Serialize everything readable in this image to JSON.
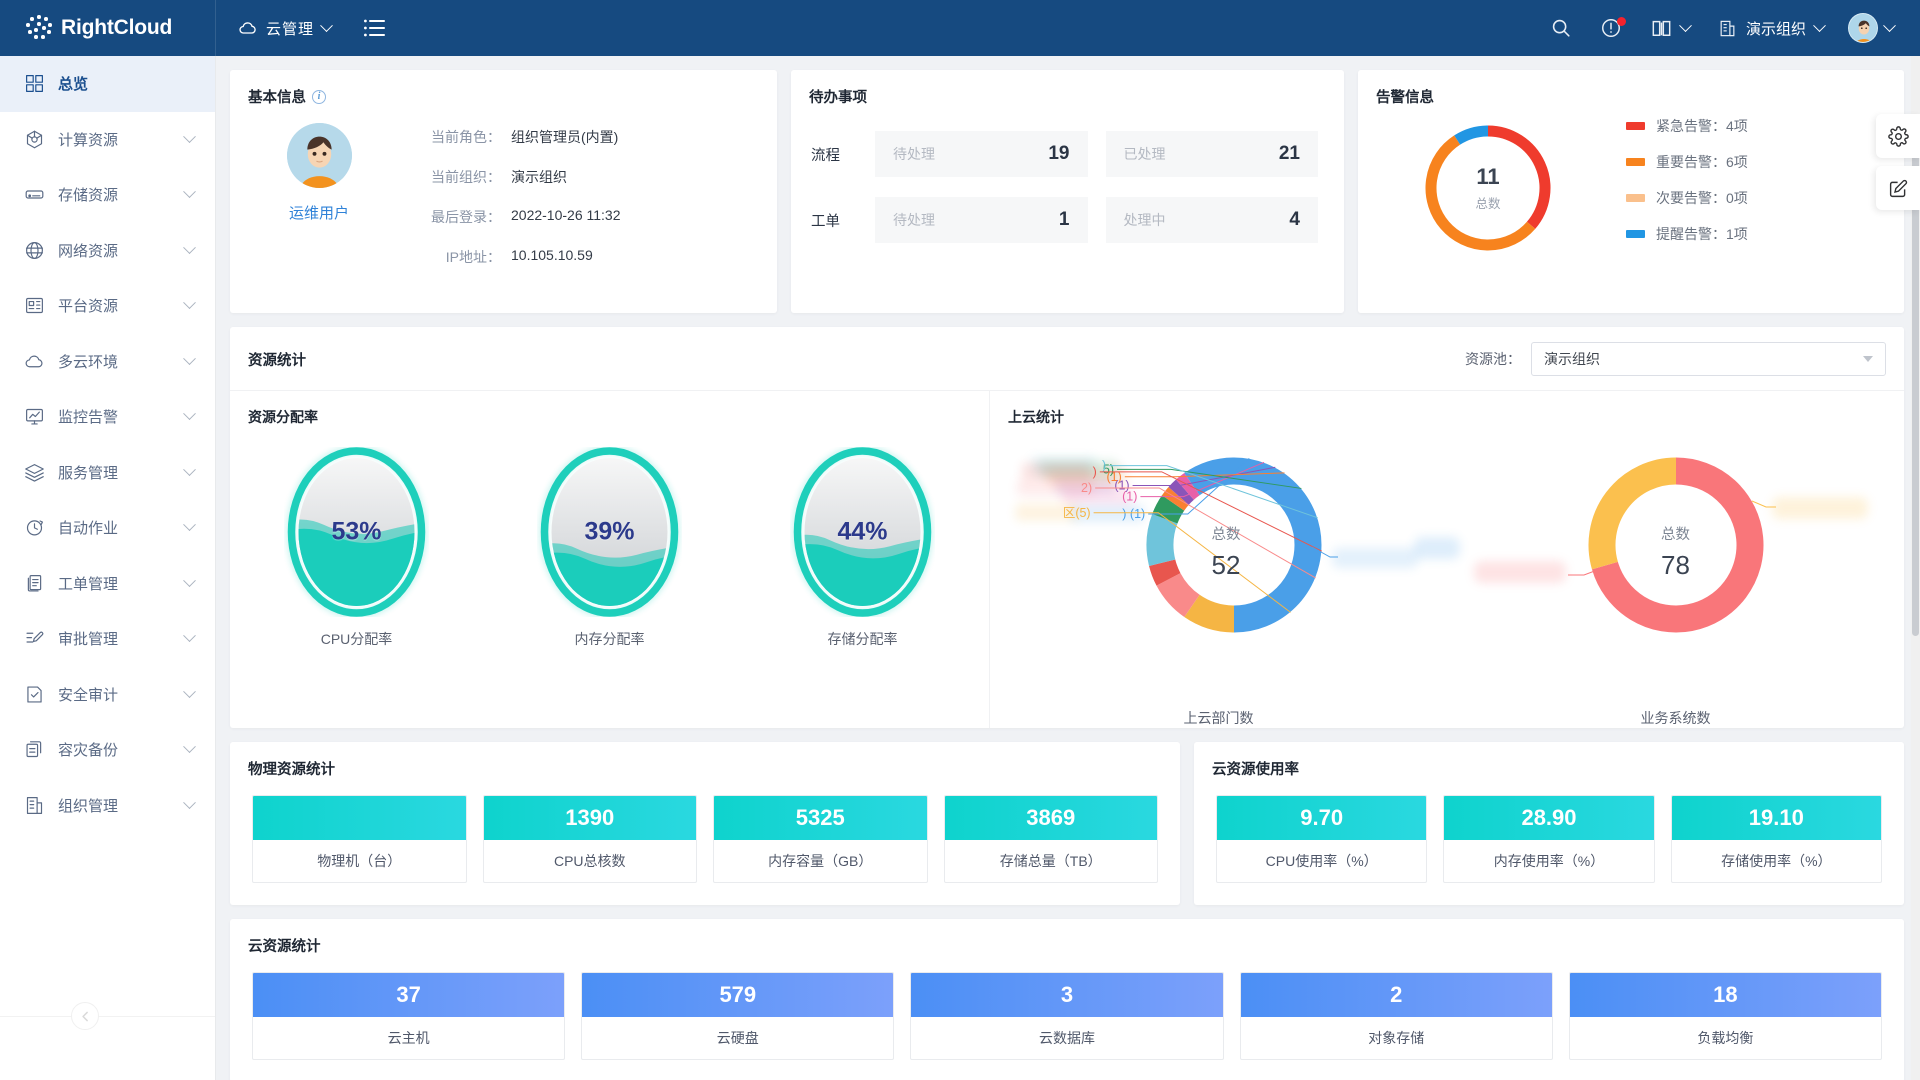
{
  "header": {
    "brand": "RightCloud",
    "module": "云管理",
    "module_icon": "cloud-icon",
    "menu_icon": "hamburger-icon",
    "search_icon": "search-icon",
    "help_icon": "exclamation-circle-icon",
    "docs_icon": "book-icon",
    "org_icon": "building-icon",
    "org_name": "演示组织",
    "avatar_icon": "user-avatar"
  },
  "sidebar": {
    "items": [
      {
        "label": "总览",
        "icon": "grid-icon",
        "active": true,
        "expandable": false
      },
      {
        "label": "计算资源",
        "icon": "cpu-icon",
        "active": false,
        "expandable": true
      },
      {
        "label": "存储资源",
        "icon": "storage-icon",
        "active": false,
        "expandable": true
      },
      {
        "label": "网络资源",
        "icon": "globe-icon",
        "active": false,
        "expandable": true
      },
      {
        "label": "平台资源",
        "icon": "layout-icon",
        "active": false,
        "expandable": true
      },
      {
        "label": "多云环境",
        "icon": "cloud-icon",
        "active": false,
        "expandable": true
      },
      {
        "label": "监控告警",
        "icon": "monitor-icon",
        "active": false,
        "expandable": true
      },
      {
        "label": "服务管理",
        "icon": "layers-icon",
        "active": false,
        "expandable": true
      },
      {
        "label": "自动作业",
        "icon": "clock-icon",
        "active": false,
        "expandable": true
      },
      {
        "label": "工单管理",
        "icon": "document-icon",
        "active": false,
        "expandable": true
      },
      {
        "label": "审批管理",
        "icon": "edit-doc-icon",
        "active": false,
        "expandable": true
      },
      {
        "label": "安全审计",
        "icon": "shield-check-icon",
        "active": false,
        "expandable": true
      },
      {
        "label": "容灾备份",
        "icon": "copy-icon",
        "active": false,
        "expandable": true
      },
      {
        "label": "组织管理",
        "icon": "building-icon",
        "active": false,
        "expandable": true
      }
    ],
    "collapse_icon": "chevron-left-icon"
  },
  "basic_info": {
    "title": "基本信息",
    "info_icon": "info-icon",
    "user_name": "运维用户",
    "rows": [
      {
        "key": "当前角色：",
        "value": "组织管理员(内置)"
      },
      {
        "key": "当前组织：",
        "value": "演示组织"
      },
      {
        "key": "最后登录：",
        "value": "2022-10-26 11:32"
      },
      {
        "key": "IP地址：",
        "value": "10.105.10.59"
      }
    ]
  },
  "todo": {
    "title": "待办事项",
    "rows": [
      {
        "label": "流程",
        "cells": [
          {
            "k": "待处理",
            "v": "19"
          },
          {
            "k": "已处理",
            "v": "21"
          }
        ]
      },
      {
        "label": "工单",
        "cells": [
          {
            "k": "待处理",
            "v": "1"
          },
          {
            "k": "处理中",
            "v": "4"
          }
        ]
      }
    ]
  },
  "alarm": {
    "title": "告警信息",
    "total": "11",
    "total_label": "总数",
    "legend": [
      {
        "label": "紧急告警：4项",
        "color": "#ef3b2d",
        "value": 4
      },
      {
        "label": "重要告警：6项",
        "color": "#f7831e",
        "value": 6
      },
      {
        "label": "次要告警：0项",
        "color": "#fac08c",
        "value": 0
      },
      {
        "label": "提醒告警：1项",
        "color": "#2196e3",
        "value": 1
      }
    ]
  },
  "resource_stats": {
    "title": "资源统计",
    "pool_label": "资源池：",
    "pool_value": "演示组织",
    "dropdown_icon": "caret-down-icon",
    "allocation": {
      "title": "资源分配率",
      "gauges": [
        {
          "caption": "CPU分配率",
          "percent": 53,
          "text": "53%"
        },
        {
          "caption": "内存分配率",
          "percent": 39,
          "text": "39%"
        },
        {
          "caption": "存储分配率",
          "percent": 44,
          "text": "44%"
        }
      ]
    },
    "cloud_stats": {
      "title": "上云统计",
      "donuts": [
        {
          "caption": "上云部门数",
          "center_label": "总数",
          "center_value": "52",
          "labels_redacted": true,
          "visible_label_fragments": [
            "] (1)",
            "(1)",
            "(1)",
            "(1)",
            "5)",
            ")",
            ")",
            "2)",
            "区(5)"
          ]
        },
        {
          "caption": "业务系统数",
          "center_label": "总数",
          "center_value": "78",
          "labels_redacted": true,
          "visible_label_fragments": []
        }
      ]
    }
  },
  "physical": {
    "title": "物理资源统计",
    "tiles": [
      {
        "value": "",
        "label": "物理机（台）"
      },
      {
        "value": "1390",
        "label": "CPU总核数"
      },
      {
        "value": "5325",
        "label": "内存容量（GB）"
      },
      {
        "value": "3869",
        "label": "存储总量（TB）"
      }
    ]
  },
  "cloud_usage": {
    "title": "云资源使用率",
    "tiles": [
      {
        "value": "9.70",
        "label": "CPU使用率（%）"
      },
      {
        "value": "28.90",
        "label": "内存使用率（%）"
      },
      {
        "value": "19.10",
        "label": "存储使用率（%）"
      }
    ]
  },
  "cloud_resources": {
    "title": "云资源统计",
    "tiles": [
      {
        "value": "37",
        "label": "云主机"
      },
      {
        "value": "579",
        "label": "云硬盘"
      },
      {
        "value": "3",
        "label": "云数据库"
      },
      {
        "value": "2",
        "label": "对象存储"
      },
      {
        "value": "18",
        "label": "负载均衡"
      }
    ]
  },
  "float_buttons": [
    {
      "icon": "gear-icon"
    },
    {
      "icon": "edit-square-icon"
    }
  ],
  "chart_data": [
    {
      "type": "pie",
      "title": "告警信息",
      "labels": [
        "紧急告警",
        "重要告警",
        "次要告警",
        "提醒告警"
      ],
      "values": [
        4,
        6,
        0,
        1
      ],
      "colors": [
        "#ef3b2d",
        "#f7831e",
        "#fac08c",
        "#2196e3"
      ],
      "total": 11,
      "legend": "right"
    },
    {
      "type": "bar",
      "title": "资源分配率",
      "categories": [
        "CPU分配率",
        "内存分配率",
        "存储分配率"
      ],
      "values": [
        53,
        39,
        44
      ],
      "ylabel": "%",
      "ylim": [
        0,
        100
      ]
    },
    {
      "type": "pie",
      "title": "上云部门数",
      "labels": [
        "(blurred)",
        "(blurred)",
        "(blurred)",
        "(blurred)",
        "(blurred)",
        "(blurred)",
        "(blurred)",
        "(blurred)",
        "(blurred)",
        "(blurred)"
      ],
      "values": [
        26,
        5,
        4,
        2,
        5,
        2,
        1,
        1,
        1,
        5
      ],
      "colors": [
        "#4a9fe8",
        "#f5b544",
        "#f98a8a",
        "#e8564e",
        "#6fc4db",
        "#2f9a5f",
        "#f98032",
        "#8a55b8",
        "#e85fa8",
        "#4a9fe8"
      ],
      "total": 52,
      "legend": "left"
    },
    {
      "type": "pie",
      "title": "业务系统数",
      "labels": [
        "(blurred)",
        "(blurred)"
      ],
      "values": [
        55,
        23
      ],
      "colors": [
        "#f9767a",
        "#fbc04e"
      ],
      "total": 78,
      "legend": "right"
    }
  ]
}
